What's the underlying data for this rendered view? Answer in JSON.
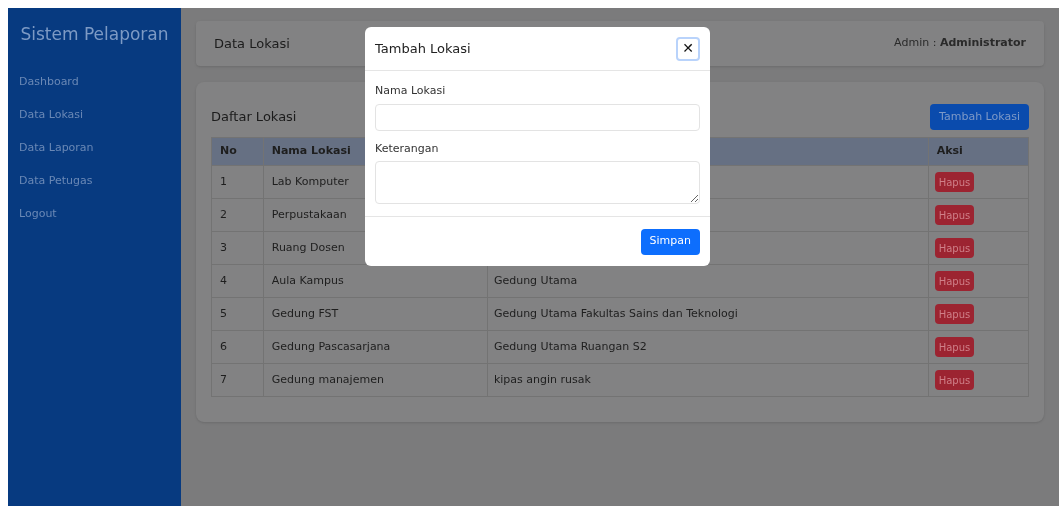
{
  "sidebar": {
    "title": "Sistem Pelaporan",
    "items": [
      {
        "label": "Dashboard"
      },
      {
        "label": "Data Lokasi"
      },
      {
        "label": "Data Laporan"
      },
      {
        "label": "Data Petugas"
      },
      {
        "label": "Logout"
      }
    ]
  },
  "header": {
    "title": "Data Lokasi",
    "user_label": "Admin :",
    "user_name": "Administrator"
  },
  "card": {
    "title": "Daftar Lokasi",
    "add_button": "Tambah Lokasi"
  },
  "table": {
    "columns": [
      {
        "label": "No"
      },
      {
        "label": "Nama Lokasi"
      },
      {
        "label": "Aksi"
      }
    ],
    "rows": [
      {
        "no": "1",
        "nama": "Lab Komputer",
        "action": "Hapus"
      },
      {
        "no": "2",
        "nama": "Perpustakaan",
        "action": "Hapus"
      },
      {
        "no": "3",
        "nama": "Ruang Dosen",
        "action": "Hapus"
      },
      {
        "no": "4",
        "nama": "Aula Kampus",
        "keterangan": "Gedung Utama",
        "action": "Hapus"
      },
      {
        "no": "5",
        "nama": "Gedung FST",
        "keterangan": "Gedung Utama Fakultas Sains dan Teknologi",
        "action": "Hapus"
      },
      {
        "no": "6",
        "nama": "Gedung Pascasarjana",
        "keterangan": "Gedung Utama Ruangan S2",
        "action": "Hapus"
      },
      {
        "no": "7",
        "nama": "Gedung manajemen",
        "keterangan": "kipas angin rusak",
        "action": "Hapus"
      }
    ]
  },
  "modal": {
    "title": "Tambah Lokasi",
    "close": "✕",
    "fields": [
      {
        "kind": "input",
        "label": "Nama Lokasi"
      },
      {
        "kind": "textarea",
        "label": "Keterangan"
      }
    ],
    "submit": "Simpan"
  }
}
